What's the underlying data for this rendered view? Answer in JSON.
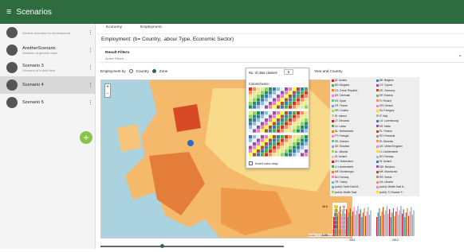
{
  "app": {
    "title": "Scenarios",
    "menu_icon": "hamburger-icon"
  },
  "sidebar": {
    "items": [
      {
        "name": "",
        "desc": "Generic scenario for development",
        "icon": "building-icon"
      },
      {
        "name": "AnotherScenario",
        "desc": "Variation of generic case",
        "icon": "building-icon"
      },
      {
        "name": "Scenario 3",
        "desc": "Scenario of a third kind",
        "icon": "building-icon"
      },
      {
        "name": "Scenario 4",
        "desc": "",
        "icon": "bar-chart-icon",
        "selected": true
      },
      {
        "name": "Scenario 5",
        "desc": "",
        "icon": "bar-chart-icon"
      }
    ],
    "fab_icon": "plus-icon"
  },
  "tabs": [
    {
      "label": "Economy"
    },
    {
      "label": "Employment"
    }
  ],
  "heading": "Employment: (b= Country, .abour Type, Economic Sector)",
  "filters": {
    "title": "Result Filters",
    "subtitle": "Active Filters:..."
  },
  "employment_by": {
    "label": "Employment by",
    "options": [
      {
        "label": "Country",
        "selected": false
      },
      {
        "label": "Zone",
        "selected": true
      }
    ]
  },
  "map": {
    "legend": [
      {
        "label": "≥ 14",
        "color": "#f2d31b"
      },
      {
        "label": "≥ 27",
        "color": "#f7b23b"
      },
      {
        "label": "≥ 40",
        "color": "#f28a33"
      },
      {
        "label": "≥ 53",
        "color": "#e85c2b"
      },
      {
        "label": "≥ 66",
        "color": "#d83a1f"
      },
      {
        "label": "≥ 80",
        "color": "#b01414"
      }
    ],
    "attribution": "Leaflet | © OpenStreetMap contributors"
  },
  "popup": {
    "classes_label": "No. of data classes",
    "classes_value": "6",
    "scheme_label": "Colorscheme:",
    "invert_label": "Invert color map"
  },
  "chart_title": "Year and Country",
  "chart_data": {
    "type": "bar",
    "categories": [
      "2011",
      "2012"
    ],
    "ylim": [
      0,
      45.5
    ],
    "ytick_labels": [
      "0.00",
      "45.5"
    ],
    "legend": [
      [
        "AT: Austria",
        "BE: Belgium"
      ],
      [
        "BG: Bulgaria",
        "CY: Cyprus"
      ],
      [
        "CZ: Czech Republic",
        "DE: Germany"
      ],
      [
        "DK: Denmark",
        "EE: Estonia"
      ],
      [
        "ES: Spain",
        "FI: Finland"
      ],
      [
        "FR: France",
        "GR: Greece"
      ],
      [
        "HR: Croatia",
        "HU: Hungary"
      ],
      [
        "IE: Ireland",
        "IT: Italy"
      ],
      [
        "LT: Lithuania",
        "LU: Luxembourg"
      ],
      [
        "LV: Latvia",
        "MT: Malta"
      ],
      [
        "NL: Netherlands",
        "PL: Poland"
      ],
      [
        "PT: Portugal",
        "RO: Romania"
      ],
      [
        "SE: Sweden",
        "SI: Slovenia"
      ],
      [
        "SK: Slovakia",
        "UK: United Kingdom"
      ],
      [
        "AL: Albania",
        "LI: Liechtenstein"
      ],
      [
        "IS: Iceland",
        "NO: Norway"
      ],
      [
        "CH: Switzerland",
        "IS: Iceland"
      ],
      [
        "LI: Liechtenstein",
        "MD: Moldova"
      ],
      [
        "ME: Montenegro",
        "MK: Macedonia"
      ],
      [
        "NO: Norway",
        "RS: Serbia"
      ],
      [
        "TR: Turkey",
        "UA: Ukraine"
      ],
      [
        "(solid): North East M...",
        "(solid): Middle East N..."
      ],
      [
        "(solid): Middle East",
        "(solid): S. Russian F..."
      ]
    ]
  },
  "colors": {
    "accent": "#2e6b3f",
    "fab": "#8bc34a"
  }
}
